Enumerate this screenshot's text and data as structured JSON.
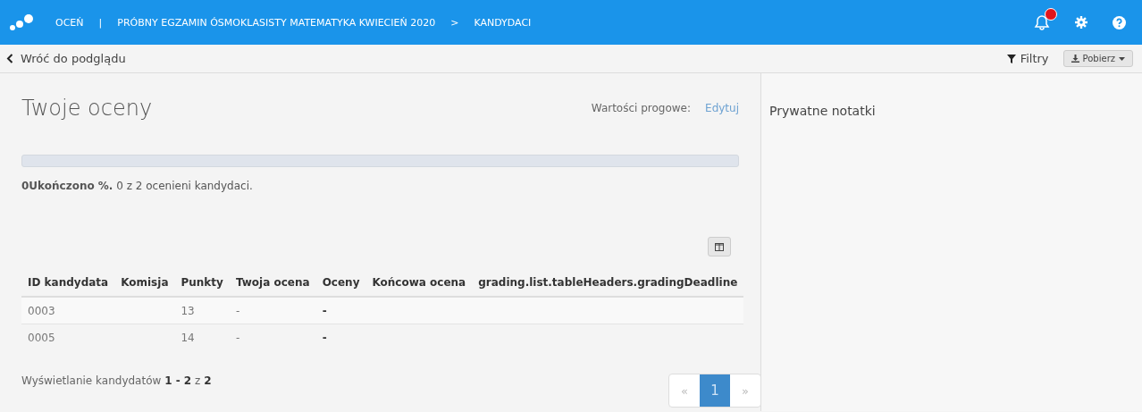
{
  "topbar": {
    "breadcrumbs": [
      {
        "label": "OCEŃ",
        "separator": "|"
      },
      {
        "label": "PRÓBNY EGZAMIN ÓSMOKLASISTY MATEMATYKA KWIECIEŃ 2020",
        "separator": ">"
      },
      {
        "label": "KANDYDACI"
      }
    ],
    "notifications_unread": true
  },
  "subbar": {
    "back": "Wróć do podglądu",
    "filters": "Filtry",
    "download": "Pobierz"
  },
  "main": {
    "title": "Twoje oceny",
    "thresholds_label": "Wartości progowe:",
    "thresholds_link": "Edytuj",
    "progress": {
      "level": 0
    },
    "summary": "**0Ukończono %.** 0 z 2 ocenieni kandydaci.",
    "table": {
      "columns": [
        "ID kandydata",
        "Komisja",
        "Punkty",
        "Twoja ocena",
        "Oceny",
        "Końcowa ocena",
        "grading.list.tableHeaders.gradingDeadline"
      ],
      "rows": [
        [
          "0003",
          "",
          "13",
          "-",
          "-",
          "",
          ""
        ],
        [
          "0005",
          "",
          "14",
          "-",
          "-",
          "",
          ""
        ]
      ]
    },
    "footer": "Wyświetlanie kandydatów **1 - 2** z **2**",
    "pagination": [
      {
        "label": "«",
        "selected": false
      },
      {
        "label": "1",
        "selected": true
      },
      {
        "label": "»",
        "selected": false
      }
    ]
  },
  "notes": {
    "title": "Prywatne notatki"
  }
}
